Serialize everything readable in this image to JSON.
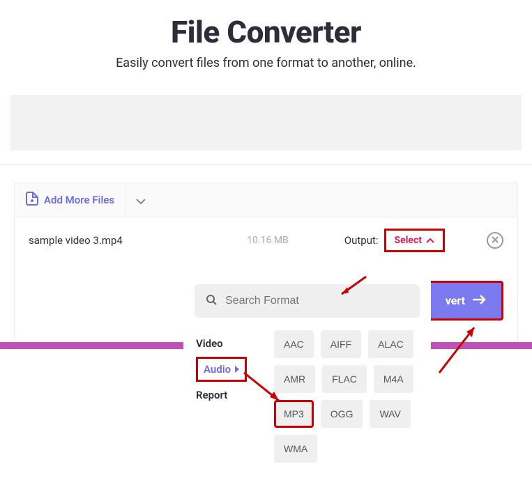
{
  "header": {
    "title": "File Converter",
    "subtitle": "Easily convert files from one format to another, online."
  },
  "addMore": {
    "label": "Add More Files"
  },
  "file": {
    "name": "sample video 3.mp4",
    "size": "10.16 MB",
    "outputLabel": "Output:",
    "selectLabel": "Select"
  },
  "convert": {
    "label": "vert"
  },
  "dropdown": {
    "searchPlaceholder": "Search Format",
    "categories": {
      "video": "Video",
      "audio": "Audio",
      "report": "Report"
    },
    "formats": {
      "aac": "AAC",
      "aiff": "AIFF",
      "alac": "ALAC",
      "amr": "AMR",
      "flac": "FLAC",
      "m4a": "M4A",
      "mp3": "MP3",
      "ogg": "OGG",
      "wav": "WAV",
      "wma": "WMA"
    }
  }
}
